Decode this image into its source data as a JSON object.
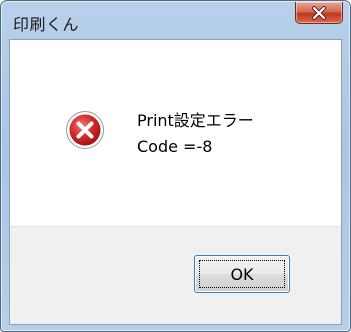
{
  "window": {
    "title": "印刷くん",
    "close_icon": "close-x-icon"
  },
  "message": {
    "icon": "error-icon",
    "line1": "Print設定エラー",
    "line2": "Code =-8"
  },
  "buttons": {
    "ok_label": "OK"
  },
  "colors": {
    "close_button": "#c2371e",
    "error_icon": "#d22d2d",
    "button_focus": "#3c7fb1"
  }
}
